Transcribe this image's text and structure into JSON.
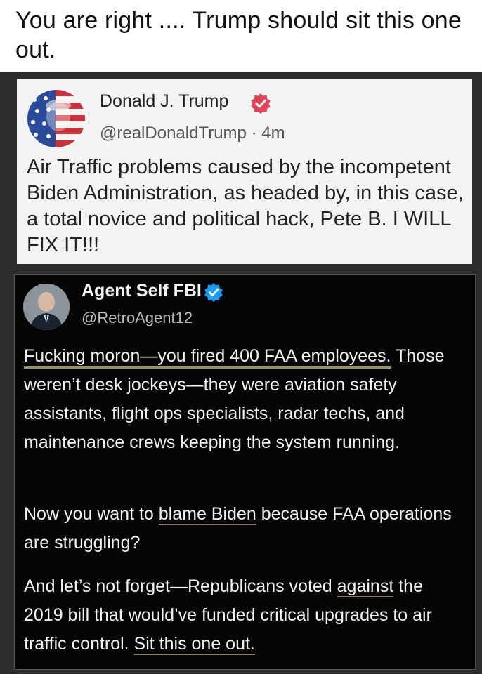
{
  "caption": "You are right .... Trump should sit this one out.",
  "trump_post": {
    "name": "Donald J. Trump",
    "handle": "@realDonaldTrump",
    "separator": "·",
    "time": "4m",
    "body": "Air Traffic problems caused by the incompetent Biden Administration, as headed by, in this case, a total novice and political hack, Pete B. I WILL FIX IT!!!",
    "verified_color": "#e0455a",
    "verified_icon": "verified-badge-icon"
  },
  "reply_post": {
    "name": "Agent Self FBI",
    "handle": "@RetroAgent12",
    "verified_color": "#1d9bf0",
    "verified_icon": "verified-badge-icon",
    "p1_a": "Fucking",
    "p1_b": " moron—you fired 400 FAA employees.",
    "p1_c": " Those weren’t desk jockeys—they were aviation safety assistants, flight ops specialists, radar techs, and maintenance crews keeping the system running.",
    "p2_a": "Now you want to ",
    "p2_b": "blame Biden",
    "p2_c": " because FAA operations are struggling?",
    "p3_a": "And let’s not forget—Republicans voted ",
    "p3_b": "against",
    "p3_c": " the 2019 bill that would’ve funded critical upgrades to air traffic control. ",
    "p3_d": "Sit this one out."
  }
}
